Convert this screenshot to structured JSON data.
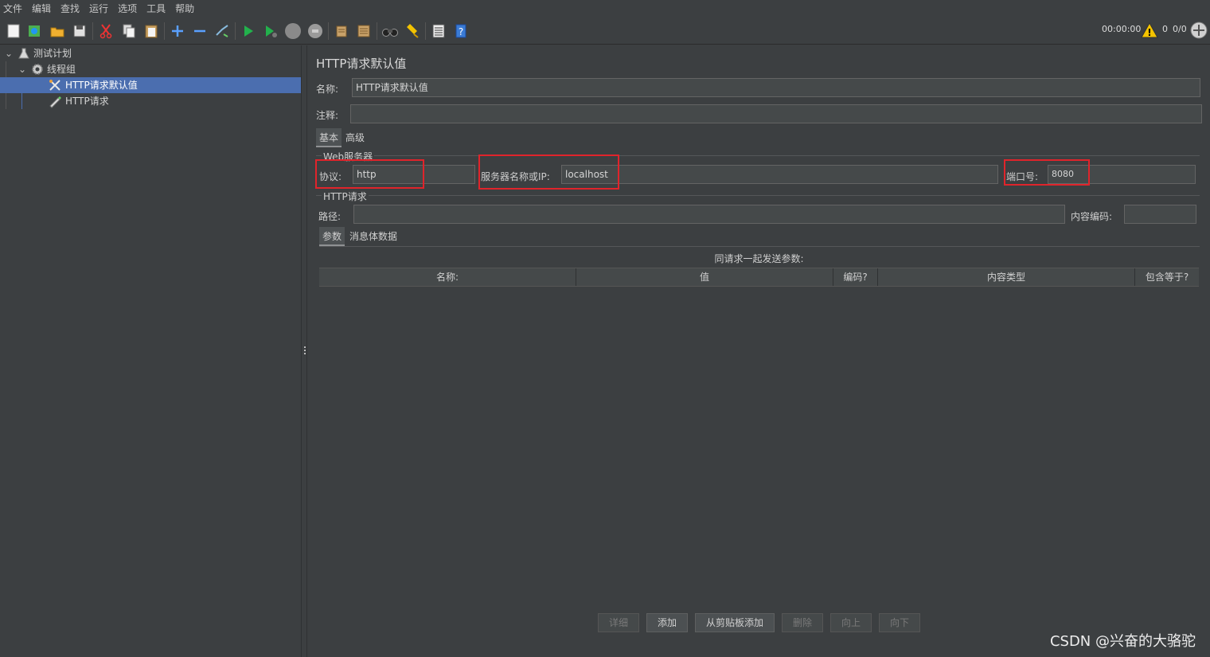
{
  "menu": [
    "文件",
    "编辑",
    "查找",
    "运行",
    "选项",
    "工具",
    "帮助"
  ],
  "toolbar": {
    "icons": [
      "new-icon",
      "templates-icon",
      "open-icon",
      "save-icon",
      "cut-icon",
      "copy-icon",
      "paste-icon",
      "expand-icon",
      "collapse-icon",
      "toggle-icon",
      "start-icon",
      "start-no-pause-icon",
      "stop-icon",
      "shutdown-icon",
      "clear-icon",
      "clear-all-icon",
      "search-icon",
      "reset-search-icon",
      "function-helper-icon",
      "help-icon"
    ],
    "timer": "00:00:00",
    "warning_count": "0",
    "threads": "0/0"
  },
  "tree": {
    "items": [
      {
        "label": "测试计划",
        "icon": "flask-icon"
      },
      {
        "label": "线程组",
        "icon": "gear-icon"
      },
      {
        "label": "HTTP请求默认值",
        "icon": "tools-icon",
        "selected": true
      },
      {
        "label": "HTTP请求",
        "icon": "pencil-icon"
      }
    ]
  },
  "panel": {
    "title": "HTTP请求默认值",
    "name_label": "名称:",
    "name_value": "HTTP请求默认值",
    "comment_label": "注释:",
    "comment_value": "",
    "tabs": [
      "基本",
      "高级"
    ],
    "web_server_section": "Web服务器",
    "protocol_label": "协议:",
    "protocol_value": "http",
    "server_label": "服务器名称或IP:",
    "server_value": "localhost",
    "port_label": "端口号:",
    "port_value": "8080",
    "http_request_section": "HTTP请求",
    "path_label": "路径:",
    "path_value": "",
    "encoding_label": "内容编码:",
    "encoding_value": "",
    "subtabs": [
      "参数",
      "消息体数据"
    ],
    "params_caption": "同请求一起发送参数:",
    "columns": [
      "名称:",
      "值",
      "编码?",
      "内容类型",
      "包含等于?"
    ],
    "buttons": [
      "详细",
      "添加",
      "从剪贴板添加",
      "删除",
      "向上",
      "向下"
    ]
  },
  "watermark": "CSDN @兴奋的大骆驼",
  "colors": {
    "background": "#3c3f41",
    "selection": "#4b6eaf",
    "highlight_box": "#e0242b"
  }
}
